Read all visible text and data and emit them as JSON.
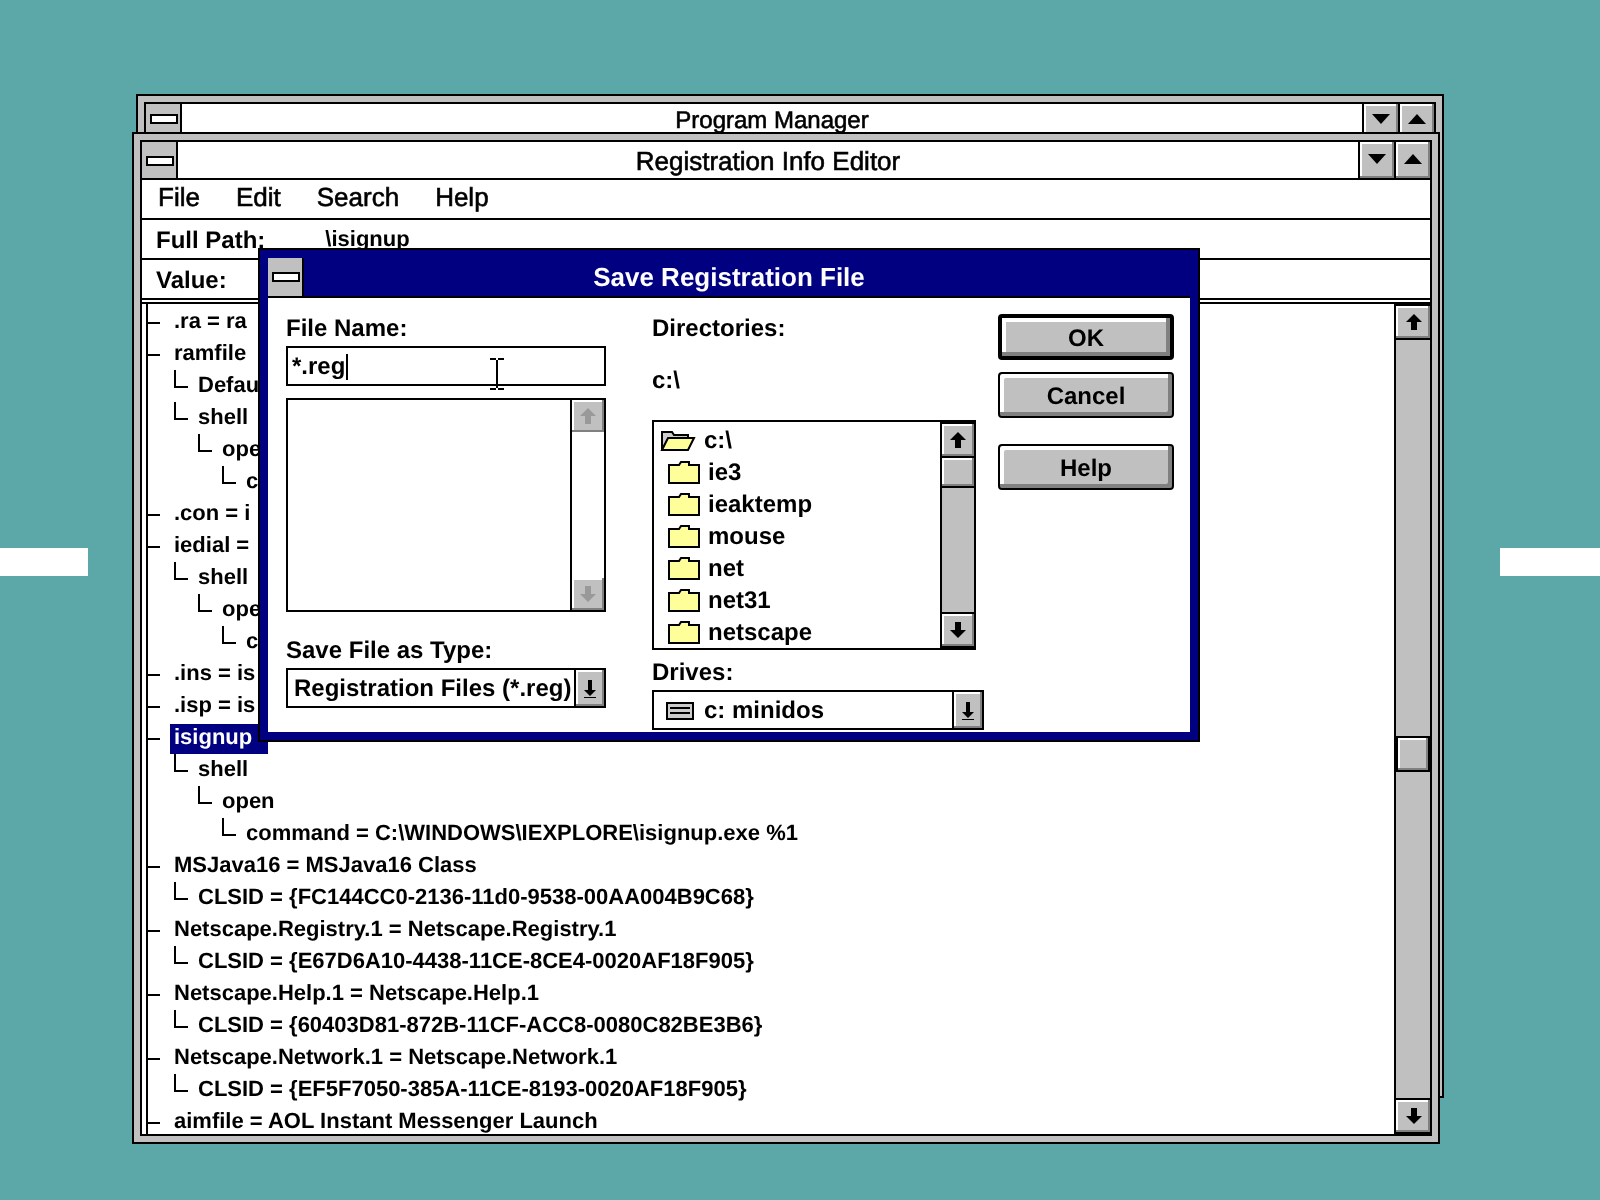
{
  "program_manager": {
    "title": "Program Manager"
  },
  "editor": {
    "title": "Registration Info Editor",
    "menu": [
      {
        "label": "File"
      },
      {
        "label": "Edit"
      },
      {
        "label": "Search"
      },
      {
        "label": "Help"
      }
    ],
    "full_path": {
      "label": "Full Path:",
      "value": "\\isignup"
    },
    "value_field": {
      "label": "Value:"
    },
    "tree": [
      {
        "text": ".ra = ra",
        "selected": false
      },
      {
        "text": "ramfile",
        "selected": false,
        "children": [
          {
            "text": "Defau",
            "selected": false
          },
          {
            "text": "shell",
            "selected": false,
            "children": [
              {
                "text": "ope",
                "selected": false,
                "children": [
                  {
                    "text": "c",
                    "selected": false
                  }
                ]
              }
            ]
          }
        ]
      },
      {
        "text": ".con = i",
        "selected": false
      },
      {
        "text": "iedial =",
        "selected": false,
        "children": [
          {
            "text": "shell",
            "selected": false,
            "children": [
              {
                "text": "ope",
                "selected": false,
                "children": [
                  {
                    "text": "c",
                    "selected": false
                  }
                ]
              }
            ]
          }
        ]
      },
      {
        "text": ".ins = is",
        "selected": false
      },
      {
        "text": ".isp = is",
        "selected": false
      },
      {
        "text": "isignup",
        "selected": true,
        "children": [
          {
            "text": "shell",
            "selected": false,
            "children": [
              {
                "text": "open",
                "selected": false,
                "children": [
                  {
                    "text": "command = C:\\WINDOWS\\IEXPLORE\\isignup.exe %1",
                    "selected": false
                  }
                ]
              }
            ]
          }
        ]
      },
      {
        "text": "MSJava16 = MSJava16 Class",
        "selected": false,
        "children": [
          {
            "text": "CLSID = {FC144CC0-2136-11d0-9538-00AA004B9C68}",
            "selected": false
          }
        ]
      },
      {
        "text": "Netscape.Registry.1 = Netscape.Registry.1",
        "selected": false,
        "children": [
          {
            "text": "CLSID = {E67D6A10-4438-11CE-8CE4-0020AF18F905}",
            "selected": false
          }
        ]
      },
      {
        "text": "Netscape.Help.1 = Netscape.Help.1",
        "selected": false,
        "children": [
          {
            "text": "CLSID = {60403D81-872B-11CF-ACC8-0080C82BE3B6}",
            "selected": false
          }
        ]
      },
      {
        "text": "Netscape.Network.1 = Netscape.Network.1",
        "selected": false,
        "children": [
          {
            "text": "CLSID = {EF5F7050-385A-11CE-8193-0020AF18F905}",
            "selected": false
          }
        ]
      },
      {
        "text": "aimfile = AOL Instant Messenger Launch",
        "selected": false
      }
    ]
  },
  "dialog": {
    "title": "Save Registration File",
    "file_name": {
      "label": "File Name:",
      "value": "*.reg"
    },
    "save_type": {
      "label": "Save File as Type:",
      "value": "Registration Files (*.reg)"
    },
    "directories": {
      "label": "Directories:",
      "path": "c:\\",
      "items": [
        {
          "name": "c:\\",
          "kind": "open"
        },
        {
          "name": "ie3",
          "kind": "folder"
        },
        {
          "name": "ieaktemp",
          "kind": "folder"
        },
        {
          "name": "mouse",
          "kind": "folder"
        },
        {
          "name": "net",
          "kind": "folder"
        },
        {
          "name": "net31",
          "kind": "folder"
        },
        {
          "name": "netscape",
          "kind": "folder"
        }
      ]
    },
    "drives": {
      "label": "Drives:",
      "value": "c: minidos"
    },
    "buttons": [
      {
        "label": "OK",
        "default": true
      },
      {
        "label": "Cancel",
        "default": false
      },
      {
        "label": "Help",
        "default": false
      }
    ]
  }
}
